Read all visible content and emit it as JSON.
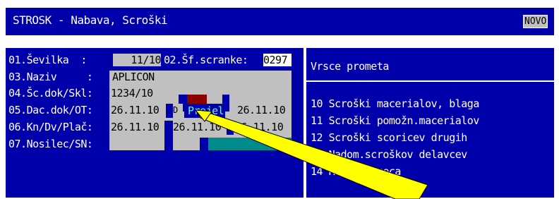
{
  "title": "STROSK - Nabava, Scroški",
  "mode_badge": "NOVO",
  "fields": {
    "f1_label": "01.Ševilka  :",
    "f1_value": " 11/10",
    "f2_label": "02.Šf.scranke:",
    "f2_value": "0297",
    "f3_label": "03.Naziv     :",
    "f3_value": "APLICON",
    "f4_label": "04.Šc.dok/Skl:",
    "f4_value": "1234/10",
    "f5_label": "05.Dac.dok/OT:",
    "f5_value": "26.11.10",
    "f5_popup_a": "D",
    "f5_popup_b": "Prejel",
    "f5_value2": "26.11.10",
    "f6_label": "06.Kn/Dv/Plač:",
    "f6_value1": "26.11.10",
    "f6_value2": "26.11.10",
    "f6_value3": "26.11.10",
    "f7_label": "07.Nosilec/SN:"
  },
  "right_header": "Vrsce prometa",
  "right_items": [
    "10 Scroški macerialov, blaga",
    "11 Scroški pomožn.macerialov",
    "12 Scroški scoricev drugih",
    "13 Nadom.scroškov delavcev",
    "14 Repr.promeca"
  ],
  "colors": {
    "screen_bg": "#0000aa",
    "text": "#ffffff",
    "field_bg": "#c0c0c0",
    "accent": "#8b0000",
    "teal": "#008b8b",
    "pointer": "#ffff00"
  }
}
